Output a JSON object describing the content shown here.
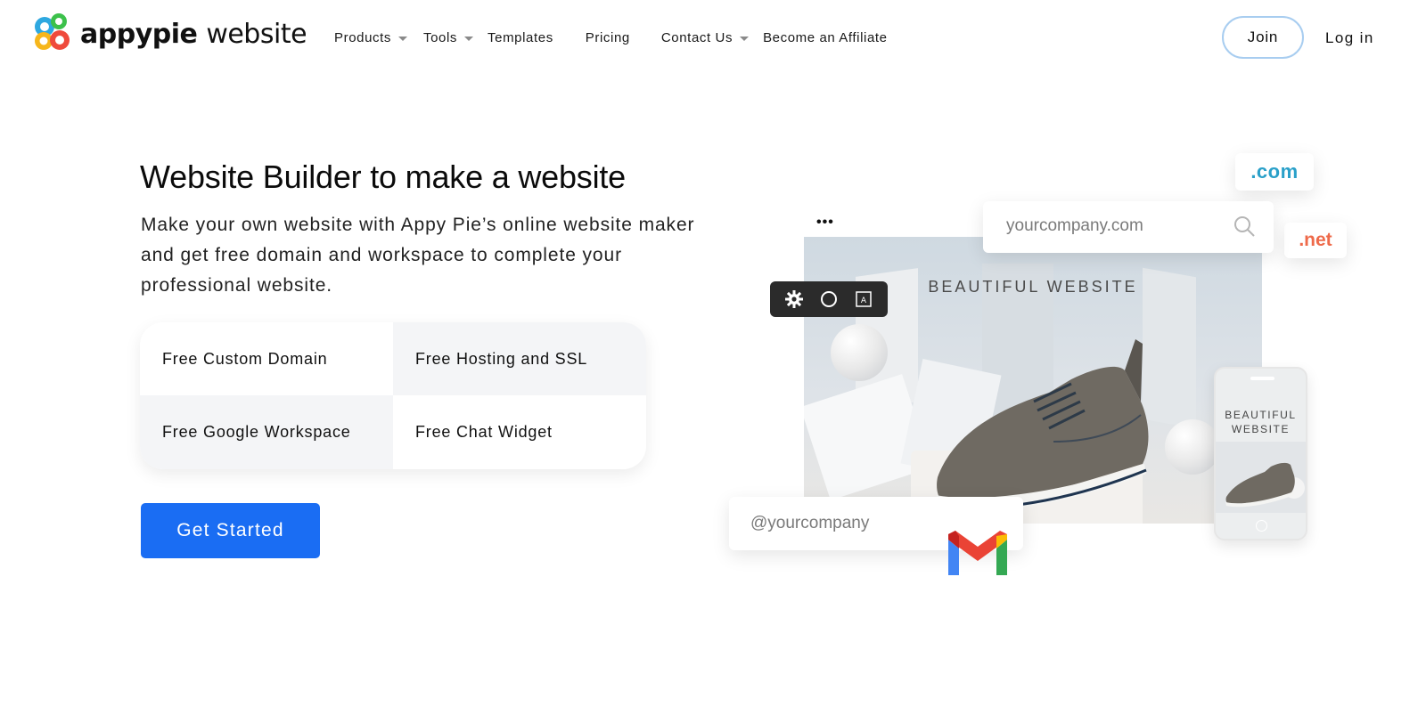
{
  "brand": {
    "name_bold": "appypie",
    "name_light": "website",
    "colors": {
      "primary": "#1a6df3",
      "join_border": "#a8cdf0",
      "com": "#2aa0c9",
      "net": "#ee6a4a"
    }
  },
  "nav": {
    "items": [
      {
        "label": "Products",
        "has_dropdown": true
      },
      {
        "label": "Tools",
        "has_dropdown": true
      },
      {
        "label": "Templates",
        "has_dropdown": false
      },
      {
        "label": "Pricing",
        "has_dropdown": false
      },
      {
        "label": "Contact Us",
        "has_dropdown": true
      },
      {
        "label": "Become an Affiliate",
        "has_dropdown": false
      }
    ],
    "join_label": "Join",
    "login_label": "Log in"
  },
  "hero": {
    "title": "Website Builder to make a website",
    "description": "Make your own website with Appy Pie’s online website maker and get free domain and workspace to complete your professional website.",
    "features": [
      "Free Custom Domain",
      "Free Hosting and SSL",
      "Free Google Workspace",
      "Free Chat Widget"
    ],
    "cta_label": "Get Started"
  },
  "illustration": {
    "tld_com": ".com",
    "tld_net": ".net",
    "browser_dots": "•••",
    "domain_placeholder": "yourcompany.com",
    "site_title": "BEAUTIFUL WEBSITE",
    "phone_title": "BEAUTIFUL WEBSITE",
    "email_placeholder": "@yourcompany",
    "toolbar_icons": [
      "gear-icon",
      "circle-icon",
      "text-style-icon"
    ],
    "toolbar_text_icon_glyph": "A"
  }
}
